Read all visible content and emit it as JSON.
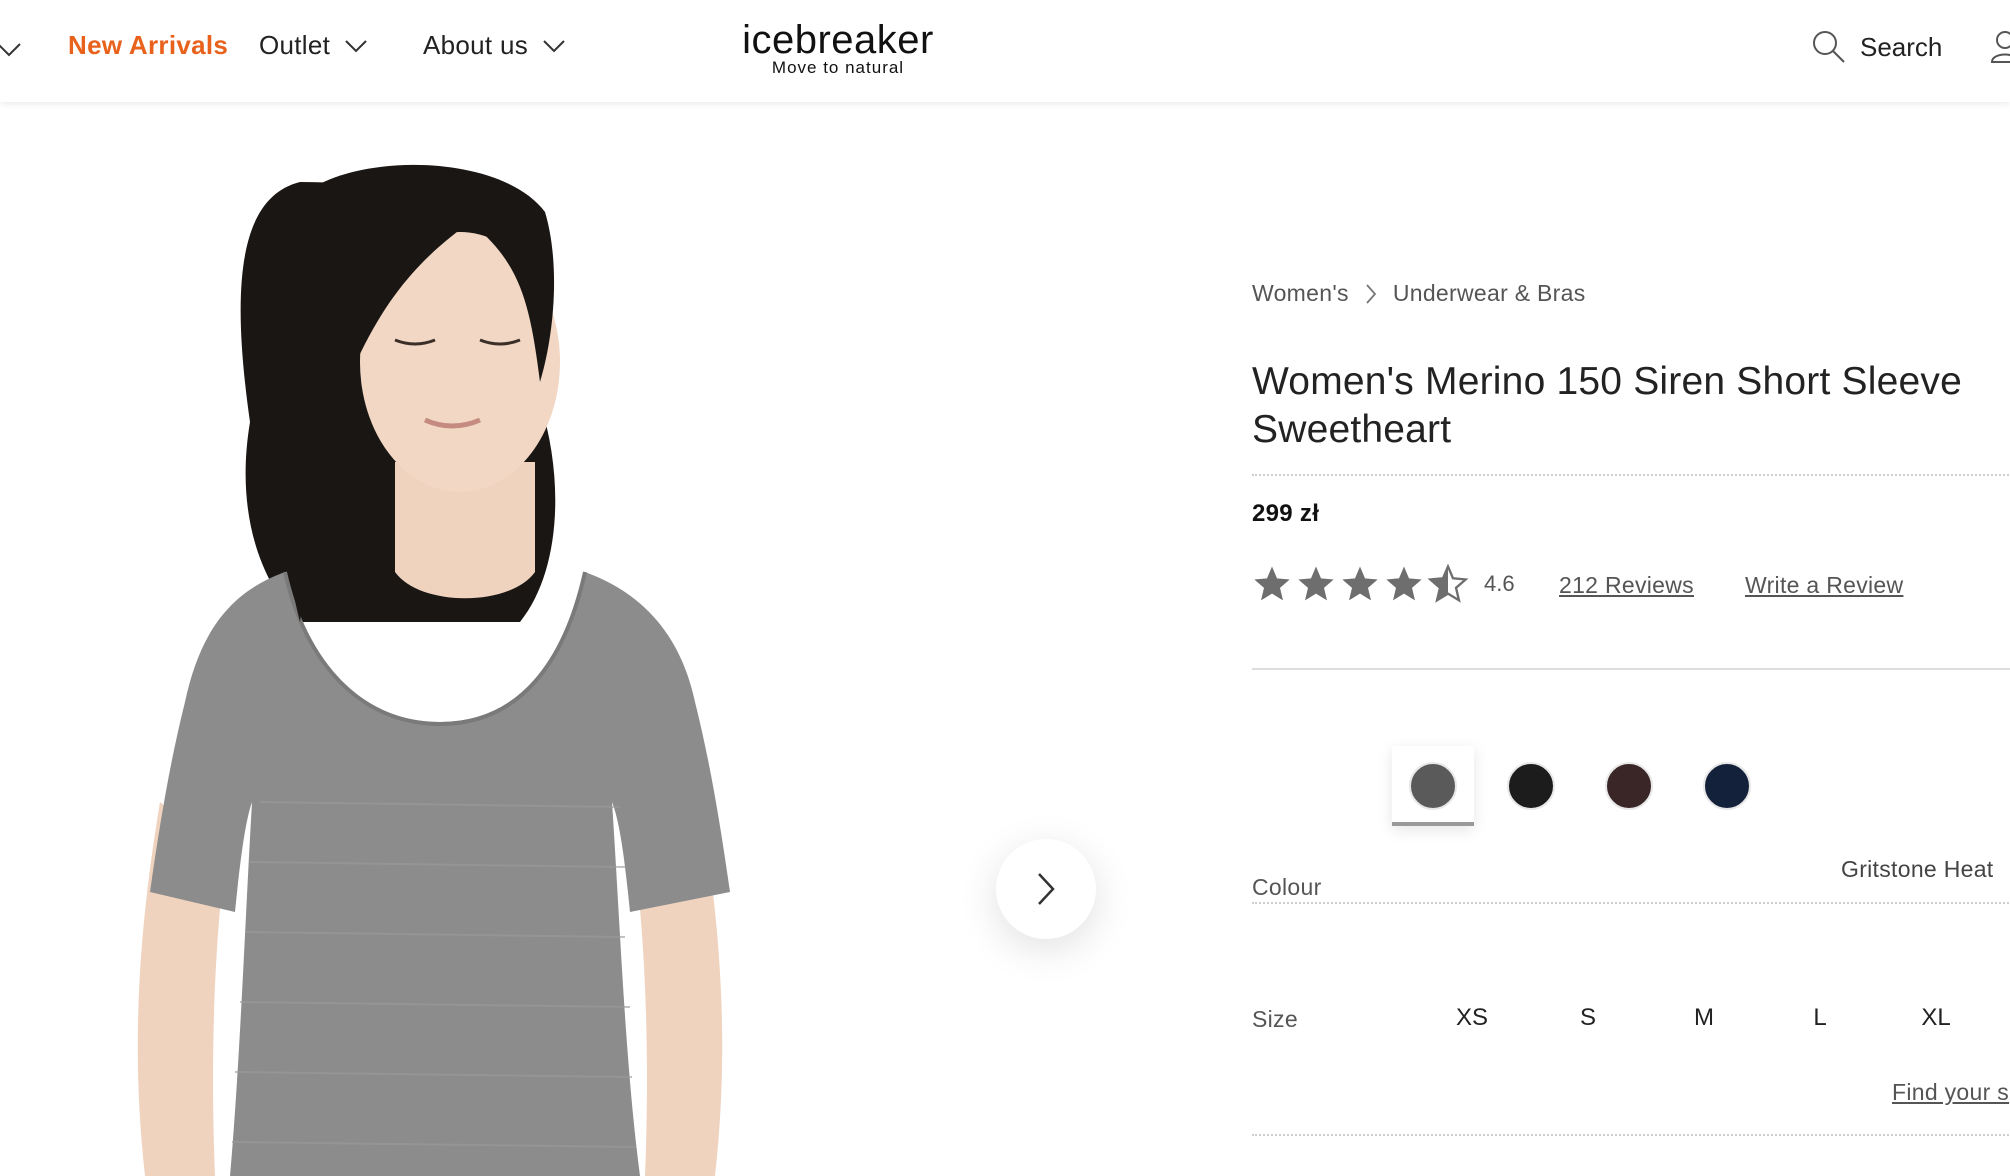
{
  "header": {
    "nav": [
      {
        "label": "New Arrivals",
        "accent": true
      },
      {
        "label": "Outlet",
        "has_dropdown": true
      },
      {
        "label": "About us",
        "has_dropdown": true
      }
    ],
    "logo": {
      "wordmark": "icebreaker",
      "tagline": "Move to natural"
    },
    "search_label": "Search"
  },
  "product": {
    "breadcrumb": [
      "Women's",
      "Underwear & Bras"
    ],
    "title": "Women's Merino 150 Siren Short Sleeve Sweetheart",
    "price": "299 zł",
    "rating": {
      "value": "4.6",
      "stars_out_of_5": 4.6
    },
    "reviews_link": "212 Reviews",
    "write_review_link": "Write a Review",
    "colour": {
      "label": "Colour",
      "selected_name": "Gritstone Heat",
      "swatches": [
        {
          "color": "#5a5a5a",
          "selected": true
        },
        {
          "color": "#1c1c1c"
        },
        {
          "color": "#3a2626"
        },
        {
          "color": "#14213a"
        }
      ]
    },
    "size": {
      "label": "Size",
      "options": [
        "XS",
        "S",
        "M",
        "L",
        "XL"
      ],
      "find_size_link": "Find your s"
    }
  },
  "colors": {
    "accent": "#e8621c",
    "shirt": "#8c8c8c",
    "hair": "#1a1614",
    "skin": "#f1d7c4"
  }
}
